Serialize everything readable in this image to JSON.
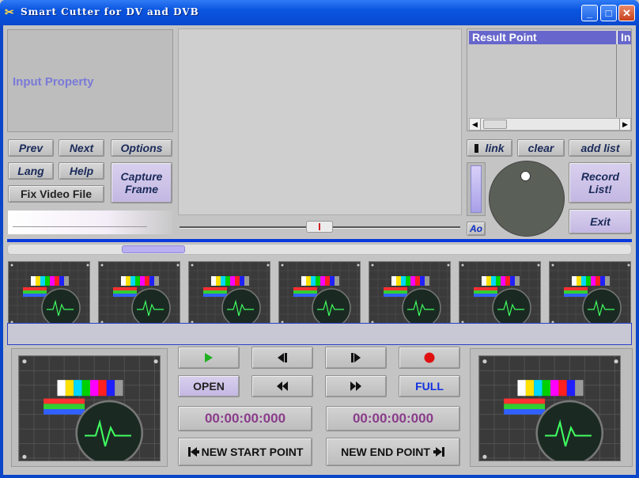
{
  "window": {
    "title": "Smart Cutter for DV and DVB"
  },
  "titlebar_buttons": {
    "minimize": "_",
    "maximize": "□",
    "close": "✕"
  },
  "input_property": {
    "label": "Input Property"
  },
  "left_buttons": {
    "prev": "Prev",
    "next": "Next",
    "options": "Options",
    "lang": "Lang",
    "help": "Help",
    "capture": "Capture Frame",
    "fix": "Fix Video File"
  },
  "result": {
    "header": "Result Point",
    "col2": "In"
  },
  "right_buttons": {
    "link": "link",
    "clear": "clear",
    "add_list": "add list",
    "record": "Record List!",
    "exit": "Exit",
    "ao": "Ao"
  },
  "transport": {
    "open": "OPEN",
    "full": "FULL",
    "start_time": "00:00:00:000",
    "end_time": "00:00:00:000",
    "new_start": "NEW START POINT",
    "new_end": "NEW END POINT"
  },
  "colors": {
    "accent": "#0a46c8",
    "time": "#8a3c8a",
    "lavender": "#c8bde6",
    "record": "#e01010",
    "play": "#20b020"
  },
  "icons": {
    "play": "play-icon",
    "step_back": "step-back-icon",
    "step_forward": "step-forward-icon",
    "record": "record-icon",
    "rewind": "rewind-icon",
    "fast_forward": "fast-forward-icon"
  },
  "thumbnails": [
    {},
    {},
    {},
    {},
    {},
    {},
    {}
  ]
}
